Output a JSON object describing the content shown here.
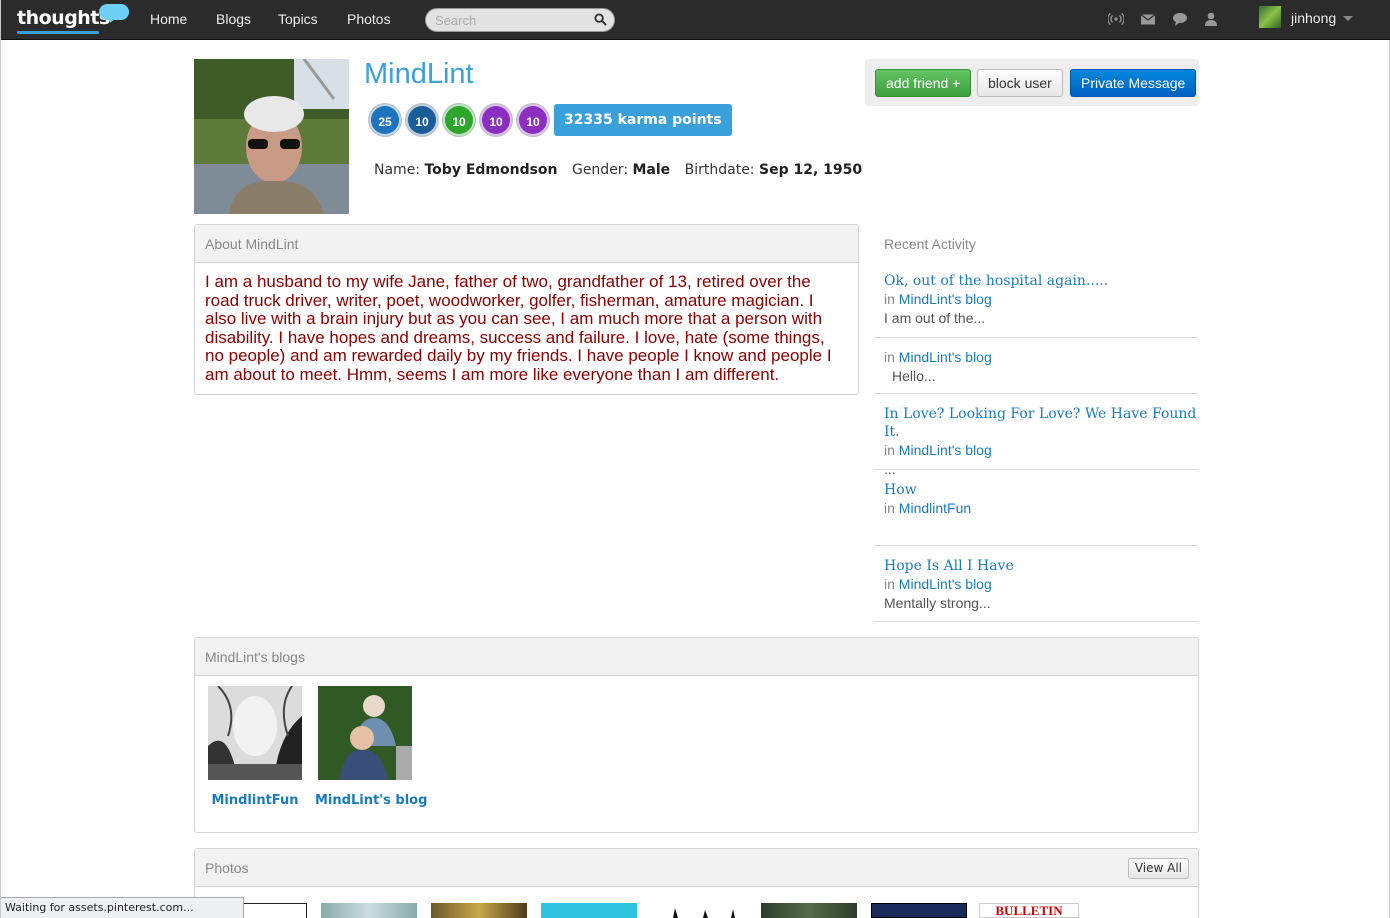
{
  "header": {
    "logo_text": "thoughts",
    "nav": [
      "Home",
      "Blogs",
      "Topics",
      "Photos"
    ],
    "search_placeholder": "Search",
    "user_name": "jinhong"
  },
  "profile": {
    "name": "MindLint",
    "badges": [
      {
        "icon": "thumbs-up-badge",
        "value": "25",
        "color": "#1e73be"
      },
      {
        "icon": "thumbs-up-badge",
        "value": "10",
        "color": "#1a5e99"
      },
      {
        "icon": "number-badge",
        "value": "10",
        "color": "#2ea62e"
      },
      {
        "icon": "speech-badge",
        "value": "10",
        "color": "#8a2fc0"
      },
      {
        "icon": "speech-badge",
        "value": "10",
        "color": "#8a2fc0"
      }
    ],
    "karma": "32335 karma points",
    "name_label": "Name:",
    "full_name": "Toby Edmondson",
    "gender_label": "Gender:",
    "gender": "Male",
    "birthdate_label": "Birthdate:",
    "birthdate": "Sep 12, 1950"
  },
  "actions": {
    "add_friend": "add friend +",
    "block_user": "block user",
    "private_message": "Private Message"
  },
  "about": {
    "heading": "About MindLint",
    "text": "I am a husband to my wife Jane, father of two, grandfather of 13, retired over the road truck driver, writer, poet, woodworker, golfer, fisherman, amature magician.  I also live with a brain injury but as you can see, I am much more that a person with disability. I have hopes and dreams, success and failure. I love, hate (some things, no people) and am rewarded daily by my friends.  I have people I know and people I am about to meet.  Hmm, seems I am more like everyone than I am different."
  },
  "recent_activity": {
    "heading": "Recent Activity",
    "items": [
      {
        "title": "Ok, out of the hospital again.....",
        "in": "in",
        "blog": "MindLint's blog",
        "snippet": "I am out of the..."
      },
      {
        "title": "",
        "in": "in",
        "blog": "MindLint's blog",
        "snippet": "Hello..."
      },
      {
        "title": "In Love? Looking For Love? We Have Found It.",
        "in": "in",
        "blog": "MindLint's blog",
        "snippet": "..."
      },
      {
        "title": "How",
        "in": "in",
        "blog": "MindlintFun",
        "snippet": ""
      },
      {
        "title": "Hope Is All I Have",
        "in": "in",
        "blog": "MindLint's blog",
        "snippet": "Mentally strong..."
      }
    ]
  },
  "blogs": {
    "heading": "MindLint's blogs",
    "items": [
      {
        "label": "MindlintFun"
      },
      {
        "label": "MindLint's blog"
      }
    ]
  },
  "photos": {
    "heading": "Photos",
    "view_all": "View All",
    "bulletin_text": "BULLETIN"
  },
  "status_bar": "Waiting for assets.pinterest.com..."
}
